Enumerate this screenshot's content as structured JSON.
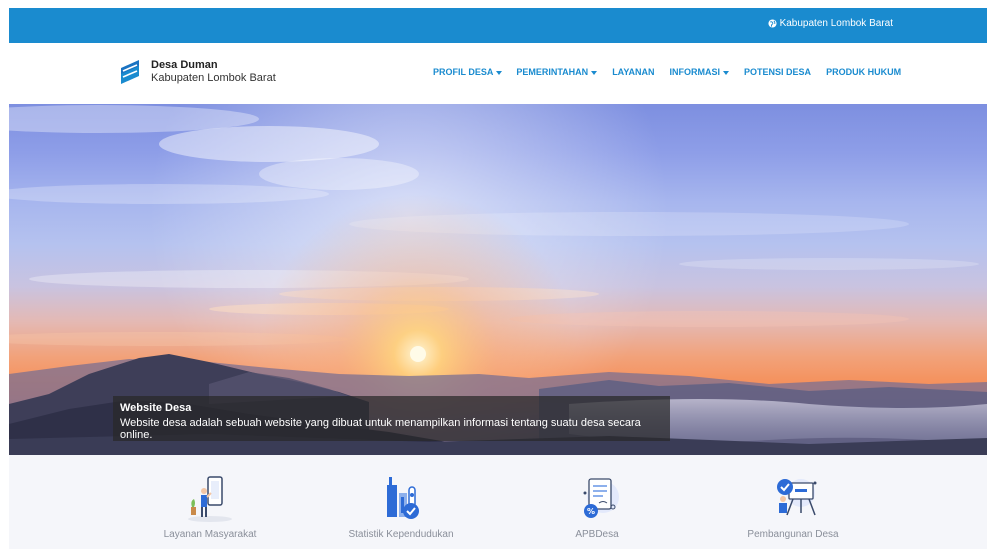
{
  "topbar": {
    "region_link": "Kabupaten Lombok Barat",
    "region_icon": "globe-icon",
    "bg_color": "#1a8bcf"
  },
  "header": {
    "brand_title": "Desa Duman",
    "brand_subtitle": "Kabupaten Lombok Barat",
    "logo_icon": "flag-logo-icon"
  },
  "nav": {
    "items": [
      {
        "label": "PROFIL DESA",
        "dropdown": true
      },
      {
        "label": "PEMERINTAHAN",
        "dropdown": true
      },
      {
        "label": "LAYANAN",
        "dropdown": false
      },
      {
        "label": "INFORMASI",
        "dropdown": true
      },
      {
        "label": "POTENSI DESA",
        "dropdown": false
      },
      {
        "label": "PRODUK HUKUM",
        "dropdown": false
      }
    ],
    "accent_color": "#1a8bcf"
  },
  "hero": {
    "caption_title": "Website Desa",
    "caption_text": "Website desa adalah sebuah website yang dibuat untuk menampilkan informasi tentang suatu desa secara online."
  },
  "services": [
    {
      "label": "Layanan Masyarakat",
      "icon": "service-desk-icon"
    },
    {
      "label": "Statistik Kependudukan",
      "icon": "statistics-icon"
    },
    {
      "label": "APBDesa",
      "icon": "budget-document-icon"
    },
    {
      "label": "Pembangunan Desa",
      "icon": "development-board-icon"
    }
  ]
}
